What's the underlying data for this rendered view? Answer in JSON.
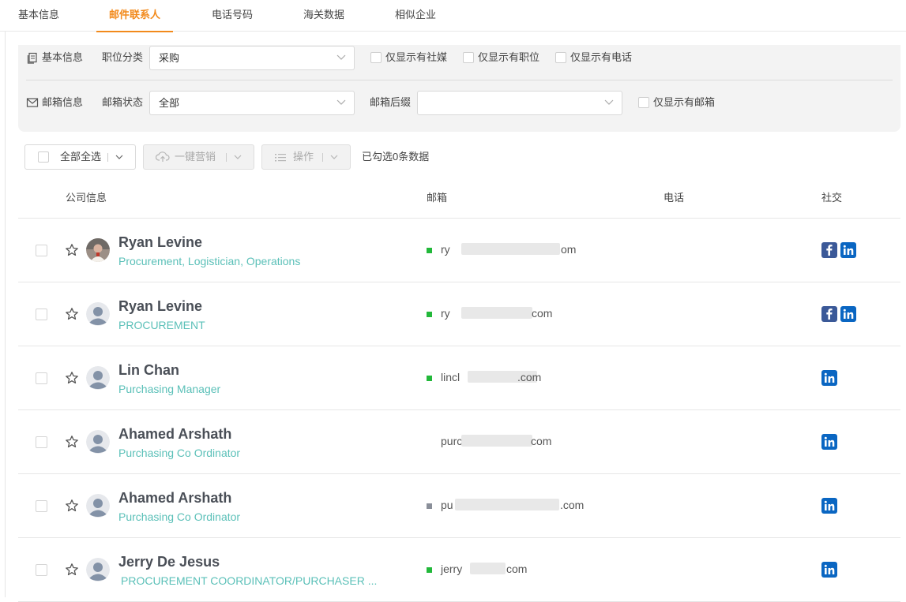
{
  "tabs": [
    {
      "label": "基本信息"
    },
    {
      "label": "邮件联系人"
    },
    {
      "label": "电话号码"
    },
    {
      "label": "海关数据"
    },
    {
      "label": "相似企业"
    }
  ],
  "filters": {
    "basic_label": "基本信息",
    "position_label": "职位分类",
    "position_value": "采购",
    "only_social": "仅显示有社媒",
    "only_position": "仅显示有职位",
    "only_phone": "仅显示有电话",
    "email_label": "邮箱信息",
    "email_status_label": "邮箱状态",
    "email_status_value": "全部",
    "email_suffix_label": "邮箱后缀",
    "email_suffix_value": "",
    "only_email": "仅显示有邮箱"
  },
  "toolbar": {
    "select_all": "全部全选",
    "marketing": "一键营销",
    "actions": "操作",
    "selected_status": "已勾选0条数据"
  },
  "table": {
    "headers": {
      "company": "公司信息",
      "email": "邮箱",
      "phone": "电话",
      "social": "社交"
    },
    "rows": [
      {
        "name": "Ryan Levine",
        "title": "Procurement, Logistician, Operations",
        "email_start": "ry",
        "email_end": "om",
        "status_color": "#22b83a",
        "social": [
          "facebook",
          "linkedin"
        ]
      },
      {
        "name": "Ryan Levine",
        "title": "PROCUREMENT",
        "email_start": "ry",
        "email_end": "com",
        "status_color": "#22b83a",
        "social": [
          "facebook",
          "linkedin"
        ]
      },
      {
        "name": "Lin Chan",
        "title": "Purchasing Manager",
        "email_start": "lincl",
        "email_end": ".com",
        "status_color": "#22b83a",
        "social": [
          "linkedin"
        ]
      },
      {
        "name": "Ahamed Arshath",
        "title": "Purchasing Co Ordinator",
        "email_start": "purc",
        "email_end": "com",
        "status_color": "",
        "social": [
          "linkedin"
        ]
      },
      {
        "name": "Ahamed Arshath",
        "title": "Purchasing Co Ordinator",
        "email_start": "pu",
        "email_end": ".com",
        "status_color": "#8a8f99",
        "social": [
          "linkedin"
        ]
      },
      {
        "name": "Jerry De Jesus",
        "title": "PROCUREMENT COORDINATOR/PURCHASER ...",
        "email_start": "jerry",
        "email_end": "com",
        "status_color": "#22b83a",
        "social": [
          "linkedin"
        ]
      }
    ]
  },
  "colors": {
    "accent": "#f28a1c",
    "title_teal": "#5bc0b8",
    "facebook": "#3b5998",
    "linkedin": "#0a66c2"
  }
}
